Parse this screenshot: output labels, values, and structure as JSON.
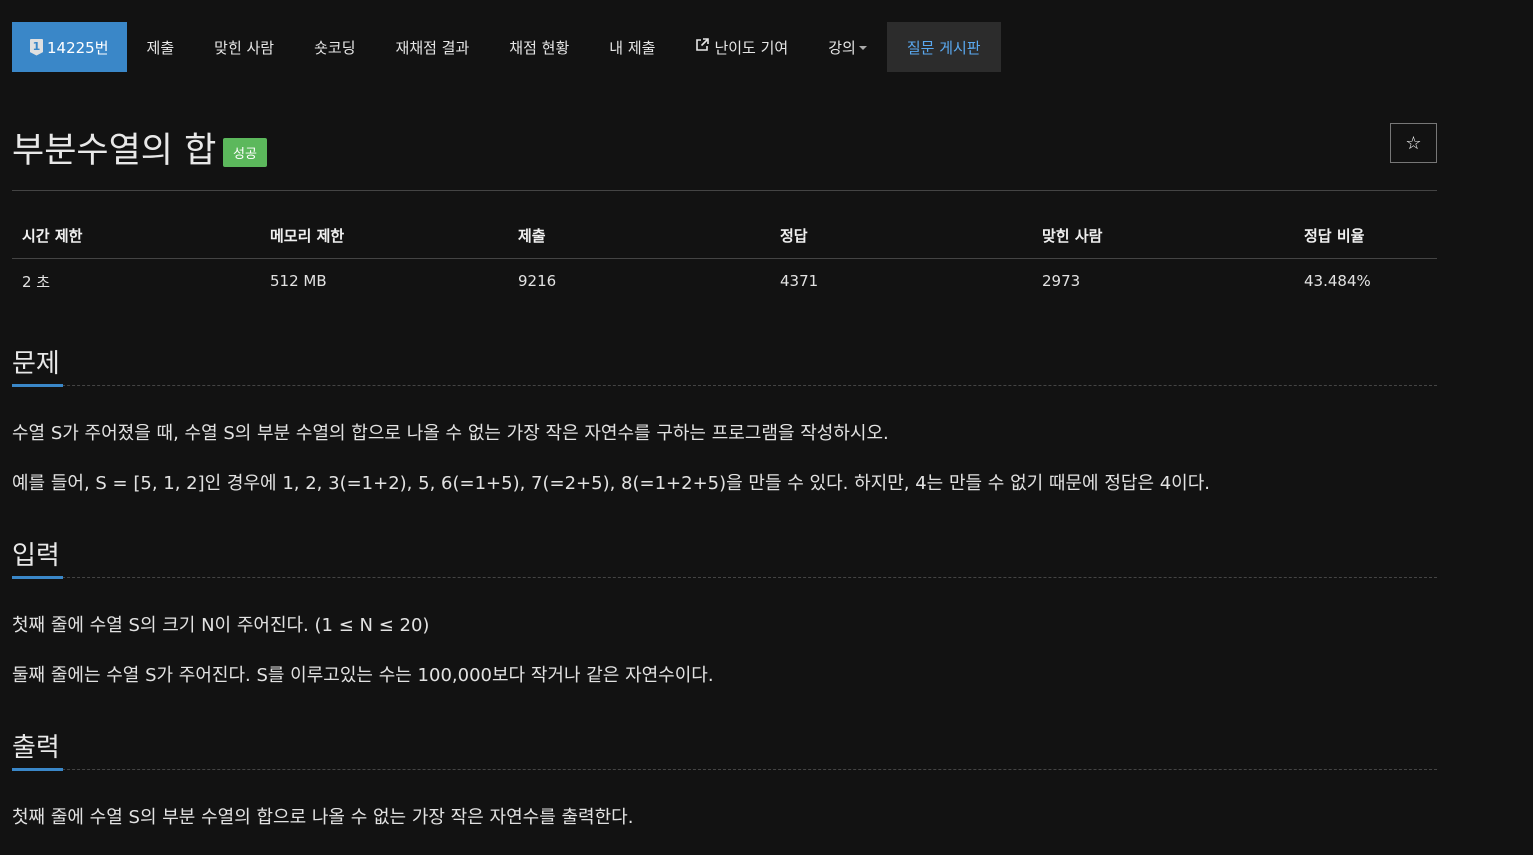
{
  "nav": {
    "problem_tier": "1",
    "problem_number": "14225번",
    "items": [
      {
        "label": "제출"
      },
      {
        "label": "맞힌 사람"
      },
      {
        "label": "숏코딩"
      },
      {
        "label": "재채점 결과"
      },
      {
        "label": "채점 현황"
      },
      {
        "label": "내 제출"
      },
      {
        "label": "난이도 기여"
      },
      {
        "label": "강의"
      },
      {
        "label": "질문 게시판"
      }
    ],
    "external_icon": "external-link-icon",
    "active_color": "#5aa9f0",
    "problem_color": "#3a87c8"
  },
  "problem": {
    "title": "부분수열의 합",
    "status": "성공",
    "status_color": "#5cb85c",
    "star": "☆"
  },
  "info": {
    "headers": [
      "시간 제한",
      "메모리 제한",
      "제출",
      "정답",
      "맞힌 사람",
      "정답 비율"
    ],
    "values": [
      "2 초",
      "512 MB",
      "9216",
      "4371",
      "2973",
      "43.484%"
    ]
  },
  "sections": {
    "description": {
      "title": "문제",
      "paragraphs": [
        "수열 S가 주어졌을 때, 수열 S의 부분 수열의 합으로 나올 수 없는 가장 작은 자연수를 구하는 프로그램을 작성하시오.",
        "예를 들어, S = [5, 1, 2]인 경우에 1, 2, 3(=1+2), 5, 6(=1+5), 7(=2+5), 8(=1+2+5)을 만들 수 있다. 하지만, 4는 만들 수 없기 때문에 정답은 4이다."
      ]
    },
    "input": {
      "title": "입력",
      "paragraphs": [
        "첫째 줄에 수열 S의 크기 N이 주어진다. (1 ≤ N ≤ 20)",
        "둘째 줄에는 수열 S가 주어진다. S를 이루고있는 수는 100,000보다 작거나 같은 자연수이다."
      ]
    },
    "output": {
      "title": "출력",
      "paragraphs": [
        "첫째 줄에 수열 S의 부분 수열의 합으로 나올 수 없는 가장 작은 자연수를 출력한다."
      ]
    }
  }
}
